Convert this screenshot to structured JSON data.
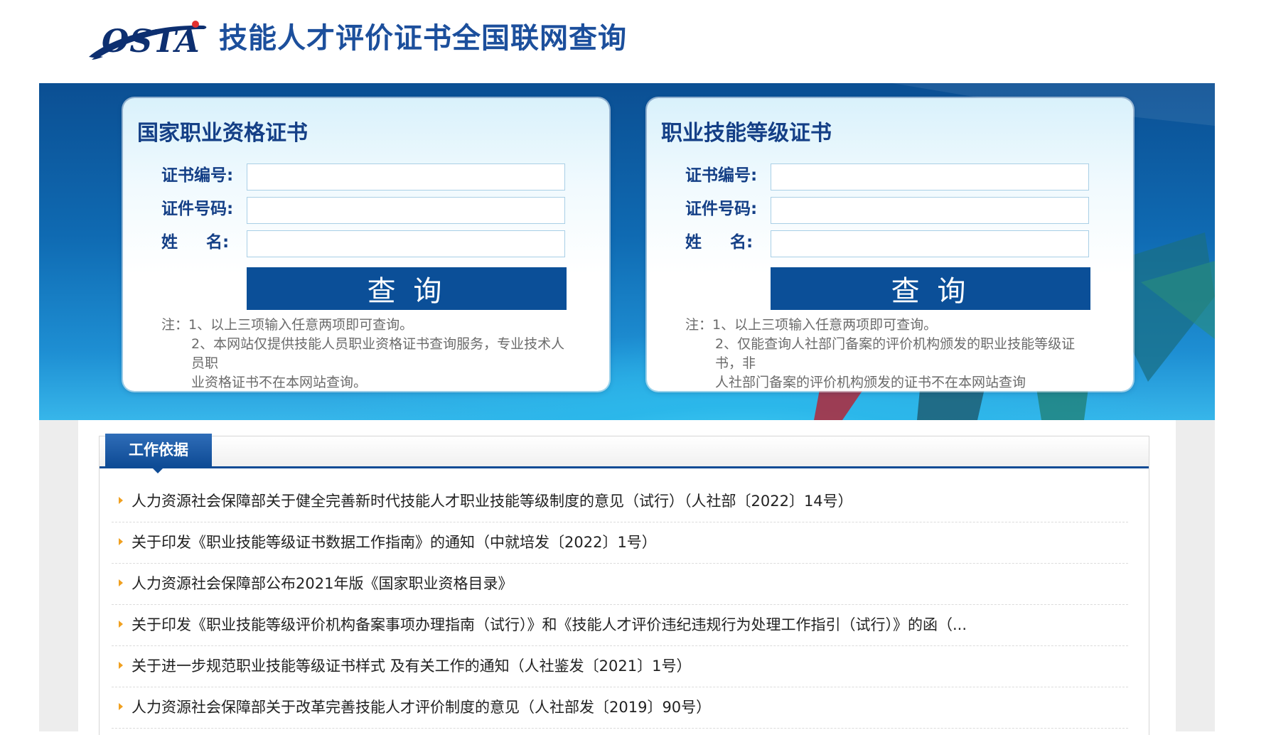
{
  "header": {
    "logo_text": "OSTA",
    "site_title": "技能人才评价证书全国联网查询"
  },
  "colors": {
    "primary_dark": "#0b4f98",
    "title_blue": "#143f86",
    "bullet_orange": "#f0a020"
  },
  "panels": [
    {
      "title": "国家职业资格证书",
      "fields": [
        {
          "label": "证书编号:",
          "value": ""
        },
        {
          "label": "证件号码:",
          "value": ""
        },
        {
          "label": "姓     名:",
          "value": ""
        }
      ],
      "button_label": "查 询",
      "notes": [
        "注：1、以上三项输入任意两项即可查询。",
        "2、本网站仅提供技能人员职业资格证书查询服务，专业技术人员职",
        "业资格证书不在本网站查询。"
      ]
    },
    {
      "title": "职业技能等级证书",
      "fields": [
        {
          "label": "证书编号:",
          "value": ""
        },
        {
          "label": "证件号码:",
          "value": ""
        },
        {
          "label": "姓     名:",
          "value": ""
        }
      ],
      "button_label": "查 询",
      "notes": [
        "注：1、以上三项输入任意两项即可查询。",
        "2、仅能查询人社部门备案的评价机构颁发的职业技能等级证书，非",
        "人社部门备案的评价机构颁发的证书不在本网站查询"
      ]
    }
  ],
  "work_basis": {
    "tab_label": "工作依据",
    "items": [
      "人力资源社会保障部关于健全完善新时代技能人才职业技能等级制度的意见（试行）（人社部〔2022〕14号）",
      "关于印发《职业技能等级证书数据工作指南》的通知（中就培发〔2022〕1号）",
      "人力资源社会保障部公布2021年版《国家职业资格目录》",
      "关于印发《职业技能等级评价机构备案事项办理指南（试行）》和《技能人才评价违纪违规行为处理工作指引（试行）》的函（...",
      "关于进一步规范职业技能等级证书样式 及有关工作的通知（人社鉴发〔2021〕1号）",
      "人力资源社会保障部关于改革完善技能人才评价制度的意见（人社部发〔2019〕90号）"
    ]
  }
}
